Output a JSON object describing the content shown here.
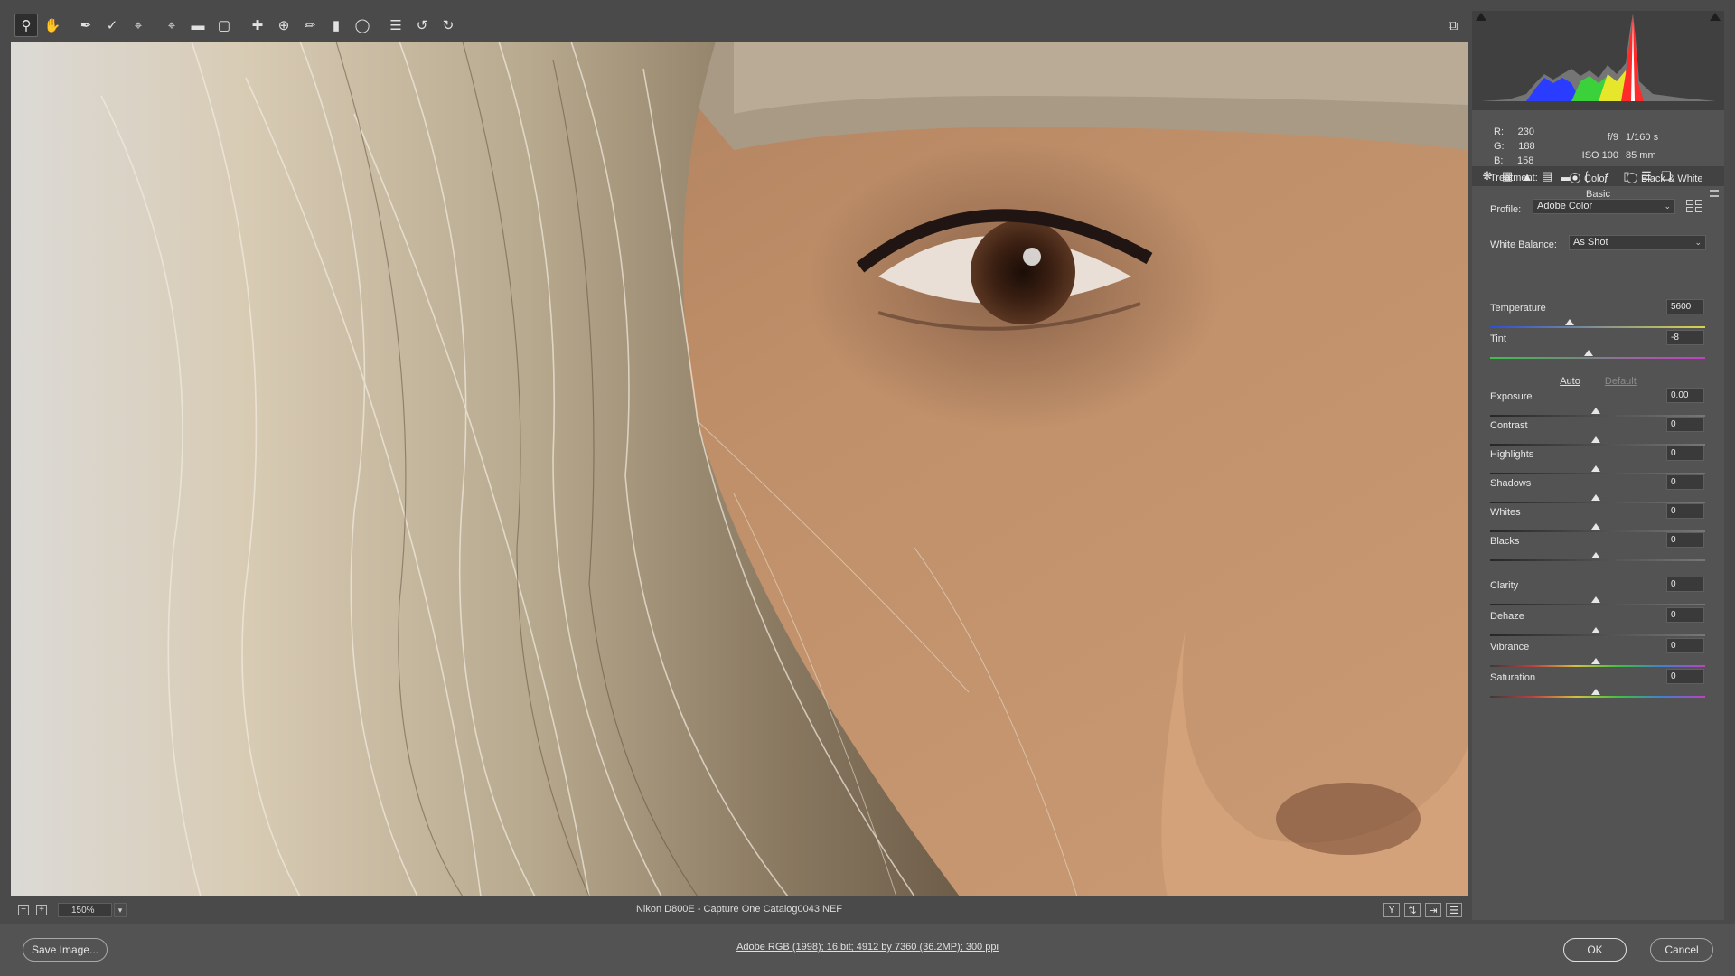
{
  "colors": {
    "panel_bg": "#535353",
    "canvas_bg": "#4a4a4a",
    "accent": "#e6e6e6"
  },
  "toolbar": {
    "tools": [
      "zoom-icon",
      "hand-icon",
      "white-balance-icon",
      "color-sampler-icon",
      "targeted-adjustment-icon",
      "crop-icon",
      "straighten-icon",
      "transform-icon",
      "spot-removal-icon",
      "red-eye-icon",
      "adjustment-brush-icon",
      "graduated-filter-icon",
      "radial-filter-icon",
      "preferences-icon",
      "rotate-left-icon",
      "rotate-right-icon"
    ],
    "fullscreen": "fullscreen-icon"
  },
  "status": {
    "zoom": "150%",
    "filename": "Nikon D800E  -  Capture One Catalog0043.NEF"
  },
  "histogram": {
    "r": "R:",
    "g": "G:",
    "b": "B:",
    "r_val": "230",
    "g_val": "188",
    "b_val": "158"
  },
  "exif": {
    "aperture": "f/9",
    "shutter": "1/160 s",
    "iso": "ISO 100",
    "focal": "85 mm"
  },
  "panel": {
    "title": "Basic",
    "treatment_label": "Treatment:",
    "treatment_color": "Color",
    "treatment_bw": "Black & White",
    "profile_label": "Profile:",
    "profile_value": "Adobe Color",
    "wb_label": "White Balance:",
    "wb_value": "As Shot",
    "auto": "Auto",
    "default": "Default",
    "sliders": [
      {
        "label": "Temperature",
        "value": "5600"
      },
      {
        "label": "Tint",
        "value": "-8"
      },
      {
        "label": "Exposure",
        "value": "0.00"
      },
      {
        "label": "Contrast",
        "value": "0"
      },
      {
        "label": "Highlights",
        "value": "0"
      },
      {
        "label": "Shadows",
        "value": "0"
      },
      {
        "label": "Whites",
        "value": "0"
      },
      {
        "label": "Blacks",
        "value": "0"
      },
      {
        "label": "Clarity",
        "value": "0"
      },
      {
        "label": "Dehaze",
        "value": "0"
      },
      {
        "label": "Vibrance",
        "value": "0"
      },
      {
        "label": "Saturation",
        "value": "0"
      }
    ]
  },
  "footer": {
    "save": "Save Image...",
    "workflow": "Adobe RGB (1998); 16 bit; 4912 by 7360 (36.2MP); 300 ppi",
    "ok": "OK",
    "cancel": "Cancel"
  }
}
